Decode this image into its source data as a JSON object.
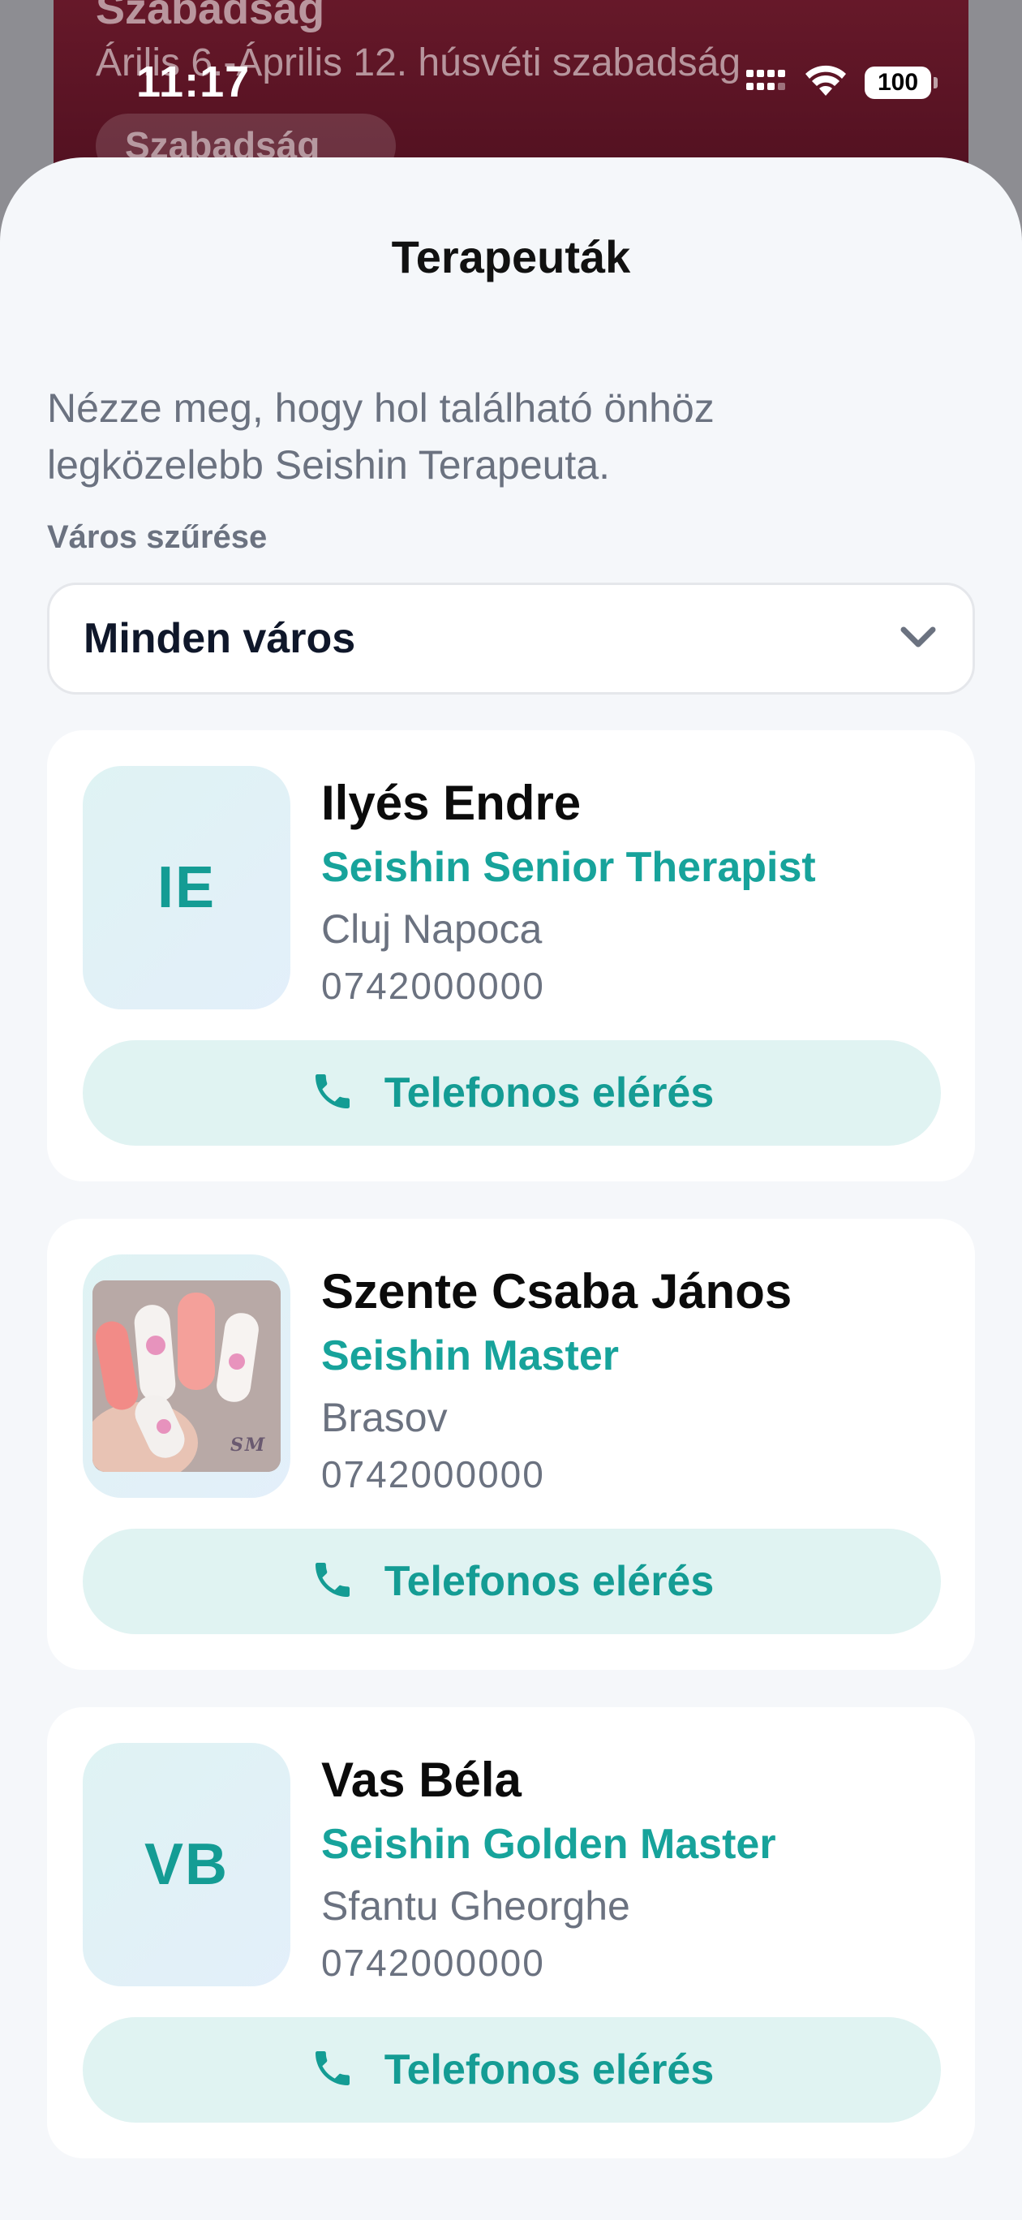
{
  "background": {
    "card_title": "Szabadság",
    "card_subtitle": "Árilis 6.-Április 12. húsvéti szabadság",
    "card_tag": "Szabadság"
  },
  "status_bar": {
    "time": "11:17",
    "battery": "100",
    "icons": [
      "signal-icon",
      "wifi-icon",
      "battery-icon"
    ]
  },
  "sheet": {
    "title": "Terapeuták",
    "intro": "Nézze meg, hogy hol található önhöz legközelebb Seishin Terapeuta.",
    "filter_label": "Város szűrése",
    "filter_value": "Minden város"
  },
  "therapists": [
    {
      "initials": "IE",
      "name": "Ilyés Endre",
      "role": "Seishin Senior Therapist",
      "city": "Cluj Napoca",
      "phone": "0742000000",
      "call_label": "Telefonos elérés",
      "has_photo": false
    },
    {
      "initials": "",
      "name": "Szente Csaba János",
      "role": "Seishin Master",
      "city": "Brasov",
      "phone": "0742000000",
      "call_label": "Telefonos elérés",
      "has_photo": true
    },
    {
      "initials": "VB",
      "name": "Vas Béla",
      "role": "Seishin Golden Master",
      "city": "Sfantu Gheorghe",
      "phone": "0742000000",
      "call_label": "Telefonos elérés",
      "has_photo": false
    }
  ],
  "colors": {
    "accent": "#17a39b",
    "button_bg": "#e0f3f2",
    "sheet_bg": "#f5f7fa",
    "background_card": "#5c1424"
  }
}
